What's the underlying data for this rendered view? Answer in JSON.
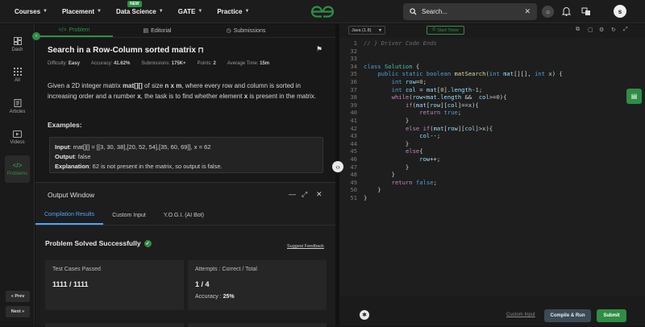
{
  "topnav": {
    "items": [
      {
        "label": "Courses"
      },
      {
        "label": "Placement"
      },
      {
        "label": "Data Science",
        "badge": "NEW"
      },
      {
        "label": "GATE"
      },
      {
        "label": "Practice"
      }
    ],
    "search_placeholder": "Search...",
    "avatar_initial": "s"
  },
  "sidebar": {
    "items": [
      {
        "label": "Dash",
        "icon": "dashboard-icon"
      },
      {
        "label": "All",
        "icon": "grid-icon"
      },
      {
        "label": "Articles",
        "icon": "article-icon"
      },
      {
        "label": "Videos",
        "icon": "video-icon"
      },
      {
        "label": "Problems",
        "icon": "code-icon"
      }
    ],
    "prev_label": "« Prev",
    "next_label": "Next »"
  },
  "left_tabs": [
    {
      "label": "Problem"
    },
    {
      "label": "Editorial"
    },
    {
      "label": "Submissions"
    }
  ],
  "problem": {
    "title": "Search in a Row-Column sorted matrix",
    "meta": {
      "difficulty_label": "Difficulty:",
      "difficulty": "Easy",
      "accuracy_label": "Accuracy:",
      "accuracy": "41.62%",
      "submissions_label": "Submissions:",
      "submissions": "175K+",
      "points_label": "Points:",
      "points": "2",
      "time_label": "Average Time:",
      "time": "15m"
    },
    "desc_1": "Given a 2D integer matrix ",
    "desc_mat": "mat[][]",
    "desc_2": " of size ",
    "desc_nxm": "n x m",
    "desc_3": ", where every row and column is sorted in increasing order and a number ",
    "desc_x": "x",
    "desc_4": ", the task is to find whether element ",
    "desc_x2": "x",
    "desc_5": " is present in the matrix.",
    "examples_heading": "Examples:",
    "example": {
      "input_label": "Input",
      "input": ": mat[][] = [[3, 30, 38],[20, 52, 54],[35, 60, 69]], x = 62",
      "output_label": "Output",
      "output": ": false",
      "explanation_label": "Explanation",
      "explanation": ": 62 is not present in the matrix, so output is false."
    }
  },
  "output_window": {
    "title": "Output Window",
    "tabs": [
      {
        "label": "Compilation Results"
      },
      {
        "label": "Custom Input"
      },
      {
        "label": "Y.O.G.I. (AI Bot)"
      }
    ],
    "status": "Problem Solved Successfully",
    "feedback": "Suggest Feedback",
    "test_cases_label": "Test Cases Passed",
    "test_cases_value": "1111 / 1111",
    "attempts_label": "Attempts : Correct / Total",
    "attempts_value": "1 / 4",
    "accuracy_label": "Accuracy :",
    "accuracy_value": "25%"
  },
  "editor": {
    "language": "Java (1.8)",
    "timer_label": "Start Timer",
    "custom_input": "Custom Input",
    "compile_run": "Compile & Run",
    "submit": "Submit",
    "lines": [
      {
        "n": "1",
        "html": "<span class=\"tok-cm\">// } Driver Code Ends</span>"
      },
      {
        "n": "32",
        "html": ""
      },
      {
        "n": "33",
        "html": ""
      },
      {
        "n": "34",
        "html": "<span class=\"tok-kw\">class</span> <span class=\"tok-ty\">Solution</span> {"
      },
      {
        "n": "35",
        "html": "    <span class=\"tok-kw\">public static boolean</span> <span class=\"tok-fn\">matSearch</span>(<span class=\"tok-kw\">int</span> <span class=\"tok-var\">mat</span>[][], <span class=\"tok-kw\">int</span> <span class=\"tok-var\">x</span>) {"
      },
      {
        "n": "36",
        "html": "        <span class=\"tok-kw\">int</span> <span class=\"tok-var\">row</span>=<span class=\"tok-num\">0</span>;"
      },
      {
        "n": "37",
        "html": "        <span class=\"tok-kw\">int</span> <span class=\"tok-var\">col</span> = <span class=\"tok-var\">mat</span>[<span class=\"tok-num\">0</span>].<span class=\"tok-var\">length</span>-<span class=\"tok-num\">1</span>;"
      },
      {
        "n": "38",
        "html": "        <span class=\"tok-ctl\">while</span>(<span class=\"tok-var\">row</span>&lt;<span class=\"tok-var\">mat</span>.<span class=\"tok-var\">length</span> &amp;&amp;  <span class=\"tok-var\">col</span>&gt;=<span class=\"tok-num\">0</span>){"
      },
      {
        "n": "39",
        "html": "            <span class=\"tok-ctl\">if</span>(<span class=\"tok-var\">mat</span>[<span class=\"tok-var\">row</span>][<span class=\"tok-var\">col</span>]==<span class=\"tok-var\">x</span>){"
      },
      {
        "n": "40",
        "html": "                <span class=\"tok-ctl\">return</span> <span class=\"tok-kw\">true</span>;"
      },
      {
        "n": "41",
        "html": "            }"
      },
      {
        "n": "42",
        "html": "            <span class=\"tok-ctl\">else if</span>(<span class=\"tok-var\">mat</span>[<span class=\"tok-var\">row</span>][<span class=\"tok-var\">col</span>]&gt;<span class=\"tok-var\">x</span>){"
      },
      {
        "n": "43",
        "html": "                <span class=\"tok-var\">col</span>--;"
      },
      {
        "n": "44",
        "html": "            }"
      },
      {
        "n": "45",
        "html": "            <span class=\"tok-ctl\">else</span>{"
      },
      {
        "n": "46",
        "html": "                <span class=\"tok-var\">row</span>++;"
      },
      {
        "n": "47",
        "html": "            }"
      },
      {
        "n": "48",
        "html": "        }"
      },
      {
        "n": "49",
        "html": "        <span class=\"tok-ctl\">return</span> <span class=\"tok-kw\">false</span>;"
      },
      {
        "n": "50",
        "html": "    }"
      },
      {
        "n": "51",
        "html": "}"
      }
    ]
  },
  "colors": {
    "brand_green": "#2f8d46",
    "accent_blue": "#4fa3ff"
  }
}
